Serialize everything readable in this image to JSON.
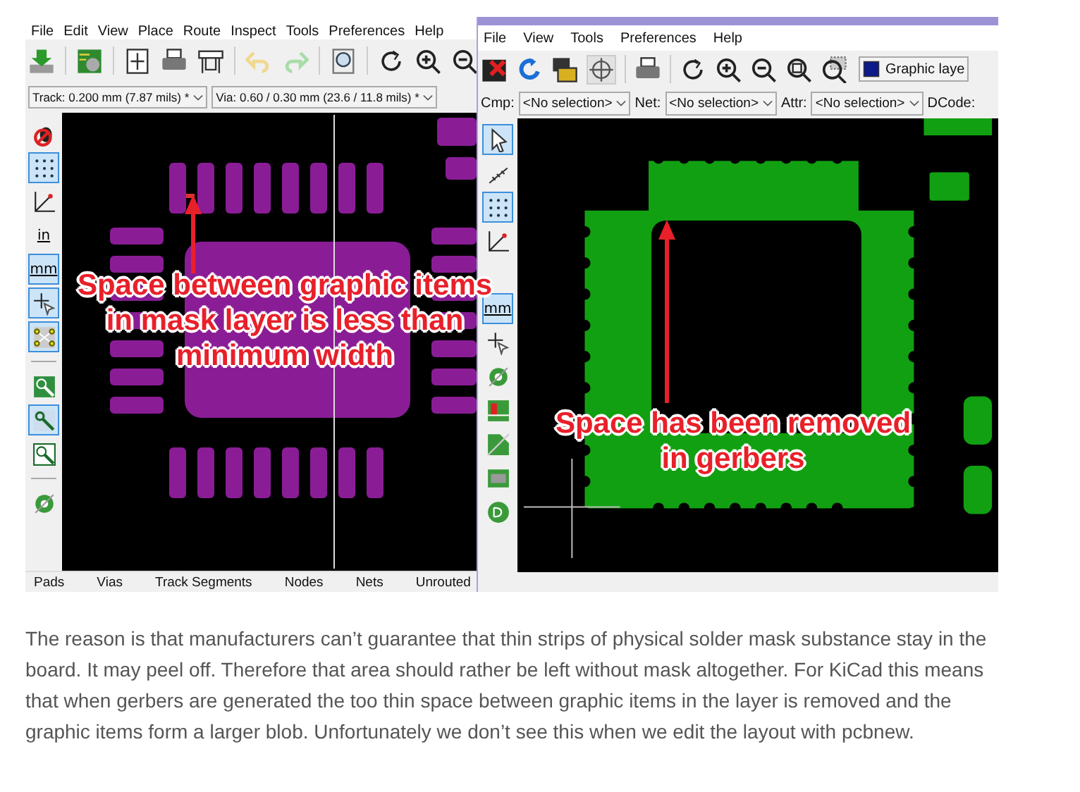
{
  "left_window": {
    "menu": [
      "File",
      "Edit",
      "View",
      "Place",
      "Route",
      "Inspect",
      "Tools",
      "Preferences",
      "Help"
    ],
    "track_select": "Track: 0.200 mm (7.87 mils) *",
    "via_select": "Via: 0.60 / 0.30 mm (23.6 / 11.8 mils) *",
    "side_tools": [
      {
        "selected": false
      },
      {
        "selected": true
      },
      {
        "selected": false
      },
      {
        "label": "in",
        "selected": false
      },
      {
        "label": "mm",
        "selected": true
      },
      {
        "selected": true
      },
      {
        "selected": true
      },
      {
        "selected": false
      },
      {
        "selected": true
      },
      {
        "selected": false
      },
      {
        "selected": false
      }
    ],
    "annotation_lines": [
      "Space between graphic items",
      "in mask layer is less than",
      "minimum width"
    ],
    "status_columns": [
      "Pads",
      "Vias",
      "Track Segments",
      "Nodes",
      "Nets",
      "Unrouted"
    ]
  },
  "right_window": {
    "menu": [
      "File",
      "View",
      "Tools",
      "Preferences",
      "Help"
    ],
    "layer_select": "Graphic laye",
    "filters": [
      {
        "label": "Cmp:",
        "value": "<No selection>"
      },
      {
        "label": "Net:",
        "value": "<No selection>"
      },
      {
        "label": "Attr:",
        "value": "<No selection>"
      }
    ],
    "dcode_label": "DCode:",
    "side_tools": [
      {
        "selected": true
      },
      {
        "selected": false
      },
      {
        "selected": true
      },
      {
        "selected": false
      },
      {
        "label": "mm",
        "selected": true
      },
      {
        "selected": false
      },
      {
        "selected": false
      },
      {
        "selected": false
      },
      {
        "selected": false
      },
      {
        "selected": false
      },
      {
        "selected": false
      }
    ],
    "annotation": "Space has been removed\nin gerbers"
  },
  "paragraph": "The reason is that manufacturers can’t guarantee that thin strips of physical solder mask substance stay in the board. It may peel off. Therefore that area should rather be left without mask altogether. For KiCad this means that when gerbers are generated the too thin space between graphic items in the layer is removed and the graphic items form a larger blob. Unfortunately we don’t see this when we edit the layout with pcbnew."
}
